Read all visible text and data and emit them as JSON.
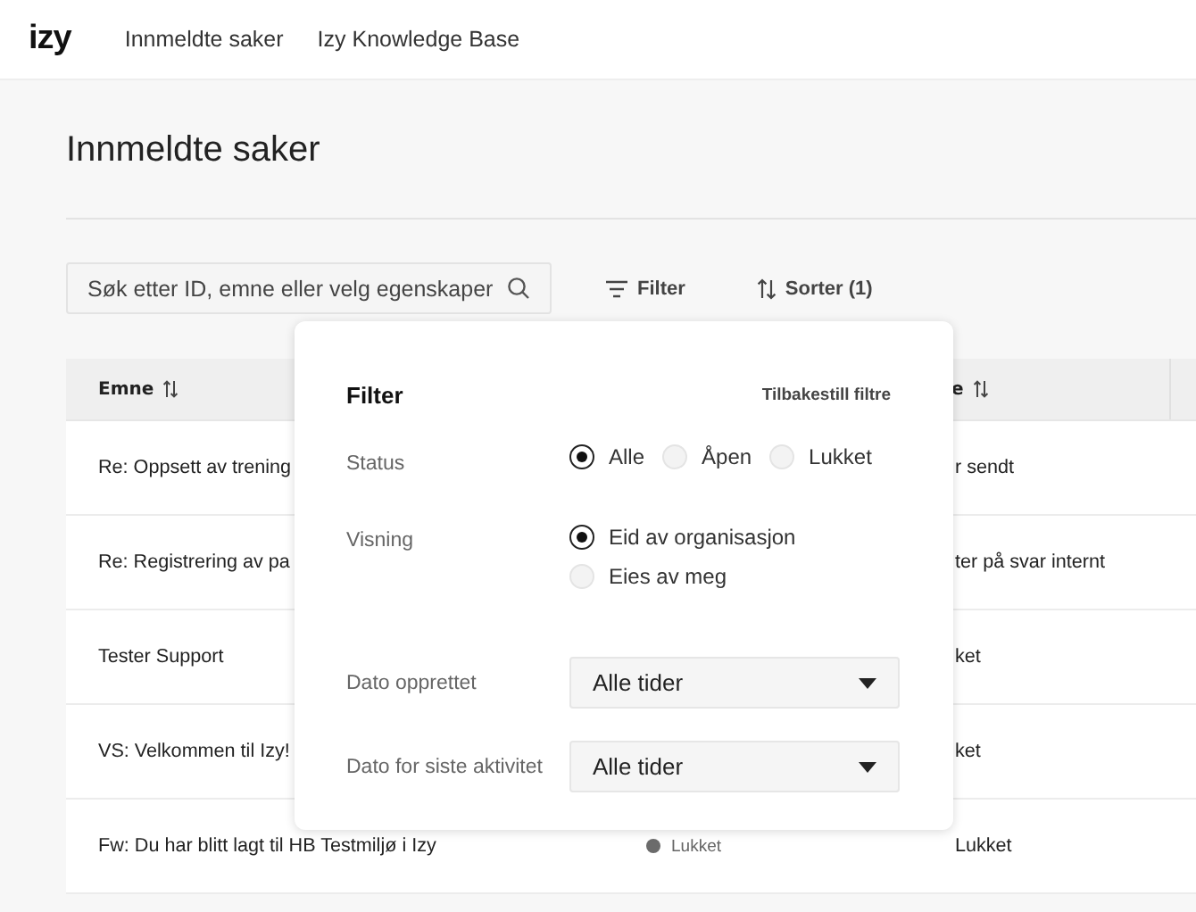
{
  "nav": {
    "logo": "izy",
    "links": [
      {
        "label": "Innmeldte saker"
      },
      {
        "label": "Izy Knowledge Base"
      }
    ]
  },
  "page_title": "Innmeldte saker",
  "search": {
    "placeholder": "Søk etter ID, emne eller velg egenskaper"
  },
  "toolbar": [
    {
      "kind": "filter",
      "label": "Filter"
    },
    {
      "kind": "sort",
      "label": "Sorter (1)"
    }
  ],
  "table": {
    "columns": [
      {
        "label": "Emne"
      },
      {
        "label": "e"
      }
    ],
    "rows": [
      {
        "subject": "Re: Oppsett av trening",
        "column_3": "r sendt"
      },
      {
        "subject": "Re: Registrering av pa",
        "column_3": "ter på svar internt"
      },
      {
        "subject": "Tester Support",
        "column_3": "ket"
      },
      {
        "subject": "VS: Velkommen til Izy!",
        "column_3": "ket"
      },
      {
        "subject": "Fw: Du har blitt lagt til HB Testmiljø i Izy",
        "status": "Lukket",
        "color": "#6b6b6b",
        "column_3": "Lukket"
      }
    ]
  },
  "filter_panel": {
    "title": "Filter",
    "reset": "Tilbakestill filtre",
    "fields": [
      {
        "kind": "radio-row",
        "label": "Status",
        "options": [
          {
            "label": "Alle",
            "selected": true
          },
          {
            "label": "Åpen",
            "selected": false
          },
          {
            "label": "Lukket",
            "selected": false
          }
        ]
      },
      {
        "kind": "radio-column",
        "label": "Visning",
        "options": [
          {
            "label": "Eid av organisasjon",
            "selected": true
          },
          {
            "label": "Eies av meg",
            "selected": false
          }
        ]
      },
      {
        "kind": "select",
        "label": "Dato opprettet",
        "value": "Alle tider"
      },
      {
        "kind": "select",
        "label": "Dato for siste aktivitet",
        "value": "Alle tider"
      }
    ]
  }
}
